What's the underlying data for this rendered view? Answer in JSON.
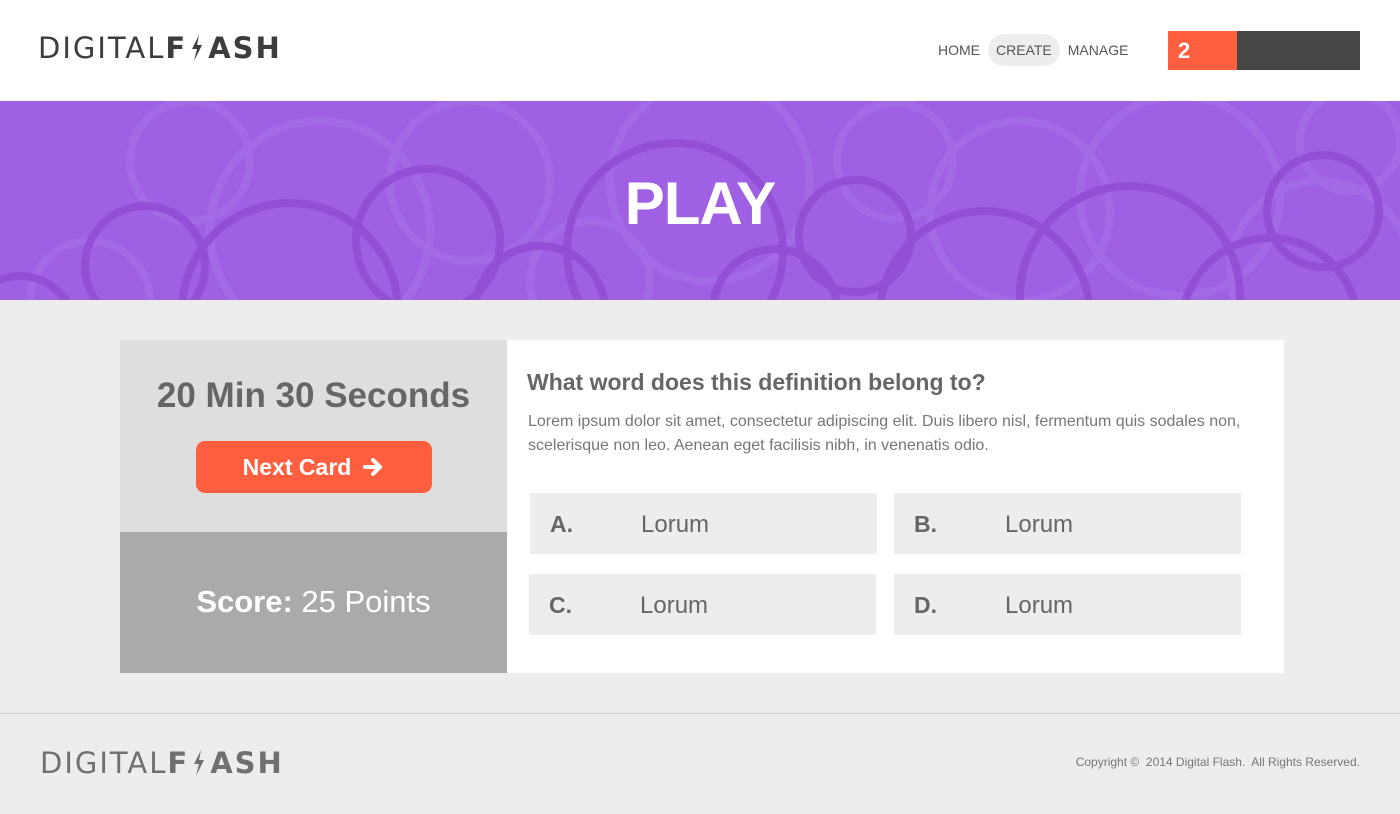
{
  "brand": {
    "part_light": "DIGITAL",
    "part_bold_1": "F",
    "part_bold_2": "ASH"
  },
  "nav": {
    "items": [
      {
        "label": "HOME"
      },
      {
        "label": "CREATE"
      },
      {
        "label": "MANAGE"
      }
    ],
    "active": "CREATE"
  },
  "user": {
    "badge_count": "2"
  },
  "hero": {
    "title": "PLAY"
  },
  "game": {
    "timer": "20 Min 30 Seconds",
    "next_button_label": "Next Card",
    "score_label": "Score:",
    "score_value": " 25 Points"
  },
  "question": {
    "title": "What word does this definition belong to?",
    "definition": "Lorem ipsum dolor sit amet, consectetur adipiscing elit. Duis libero nisl, fermentum quis sodales non, scelerisque non leo. Aenean eget facilisis nibh, in venenatis odio.",
    "answers": [
      {
        "letter": "A.",
        "text": "Lorum"
      },
      {
        "letter": "B.",
        "text": "Lorum"
      },
      {
        "letter": "C.",
        "text": "Lorum"
      },
      {
        "letter": "D.",
        "text": "Lorum"
      }
    ]
  },
  "footer": {
    "copyright": "Copyright ©  2014 Digital Flash.  All Rights Reserved."
  },
  "colors": {
    "accent": "#ff5f3e",
    "hero_purple": "#a060e4",
    "dark": "#464646",
    "panel_light": "#dedede",
    "panel_mid": "#aaaaaa",
    "background": "#ededed"
  },
  "icons": {
    "bolt": "lightning-bolt-icon",
    "arrow": "arrow-right-icon"
  }
}
